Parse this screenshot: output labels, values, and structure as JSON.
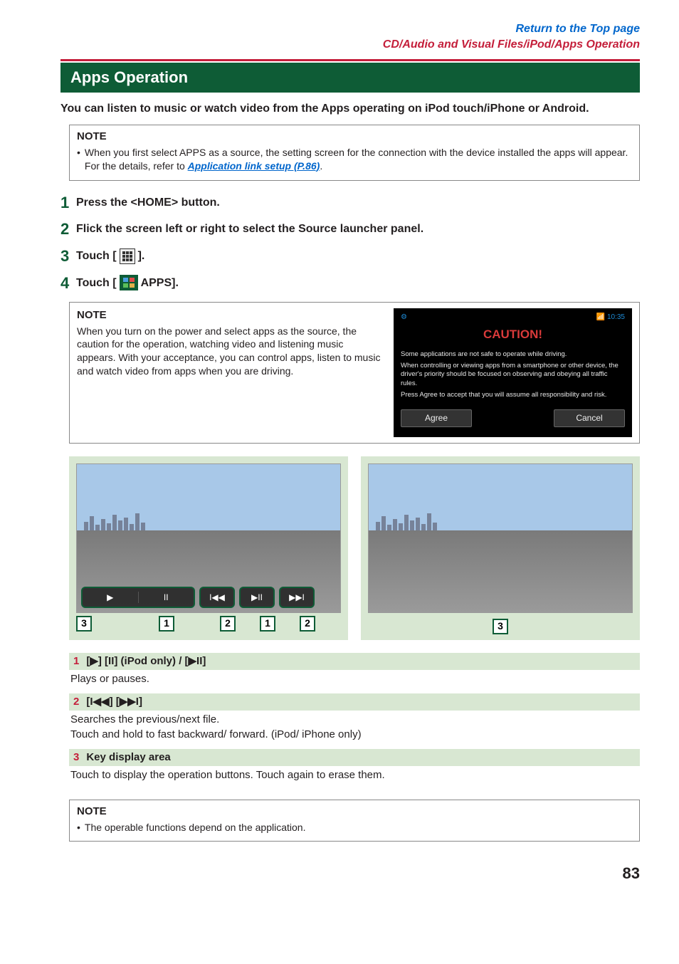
{
  "breadcrumb": {
    "top_link": "Return to the Top page",
    "section": "CD/Audio and Visual Files/iPod/Apps Operation"
  },
  "title": "Apps Operation",
  "intro": "You can listen to music or watch video from the Apps operating on iPod touch/iPhone or Android.",
  "note1": {
    "head": "NOTE",
    "body_pre": "When you first select APPS as a source, the setting screen for the connection with the device installed the apps will appear. For the details, refer to ",
    "link": "Application link setup (P.86)",
    "body_post": "."
  },
  "steps": [
    {
      "num": "1",
      "text": "Press the <HOME> button."
    },
    {
      "num": "2",
      "text": "Flick the screen left or right to select the Source launcher panel."
    },
    {
      "num": "3",
      "pre": "Touch [",
      "post": "]."
    },
    {
      "num": "4",
      "pre": "Touch [",
      "post": "APPS]."
    }
  ],
  "note2": {
    "head": "NOTE",
    "body": "When you turn on the power and select apps as the source, the caution for the operation, watching video and listening music appears. With your acceptance, you can control apps, listen to music and watch video from apps when you are driving."
  },
  "caution_screen": {
    "wifi": "⚙",
    "time": "10:35",
    "title": "CAUTION!",
    "lines": [
      "Some applications are not safe to operate while driving.",
      "When controlling or viewing apps from a smartphone or other device, the driver's priority should be focused on observing and obeying all traffic rules.",
      "Press Agree to accept that you will assume all responsibility and risk."
    ],
    "agree": "Agree",
    "cancel": "Cancel"
  },
  "figure": {
    "btn_play": "▶",
    "btn_pause": "II",
    "btn_prev": "I◀◀",
    "btn_playpause": "▶II",
    "btn_next": "▶▶I",
    "callouts_left": [
      "3",
      "1",
      "2",
      "1",
      "2"
    ],
    "callout_right": "3"
  },
  "defs": [
    {
      "num": "1",
      "label": "[▶] [II] (iPod only) / [▶II]",
      "body": "Plays or pauses."
    },
    {
      "num": "2",
      "label": "[I◀◀] [▶▶I]",
      "body": "Searches the previous/next file.\nTouch and hold to fast backward/ forward. (iPod/ iPhone only)"
    },
    {
      "num": "3",
      "label": "Key display area",
      "body": "Touch to display the operation buttons. Touch again to erase them."
    }
  ],
  "note3": {
    "head": "NOTE",
    "body": "The operable functions depend on the application."
  },
  "page_number": "83"
}
